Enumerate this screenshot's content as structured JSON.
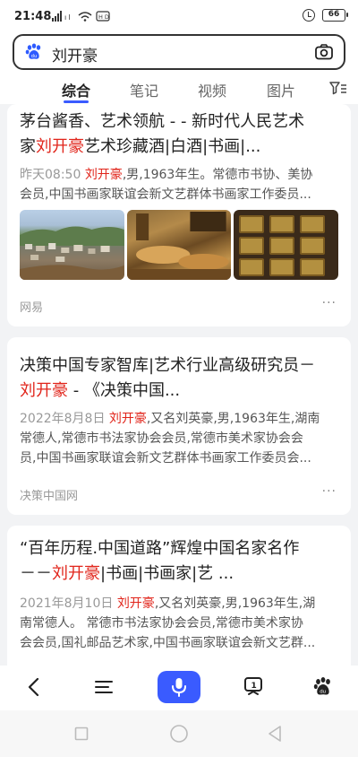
{
  "status_bar": {
    "time": "21:48",
    "left_icons": "Ⓢ ᴵ ⊙ ↗",
    "battery": "66"
  },
  "search": {
    "query": "刘开豪"
  },
  "tabs": [
    {
      "label": "综合",
      "active": true
    },
    {
      "label": "笔记",
      "active": false
    },
    {
      "label": "视频",
      "active": false
    },
    {
      "label": "图片",
      "active": false
    }
  ],
  "results": [
    {
      "title_line1": "茅台酱香、艺术领航 - - 新时代人民艺术",
      "title_line2_pre": "家",
      "title_line2_hl": "刘开豪",
      "title_line2_post": "艺术珍藏酒|白酒|书画|...",
      "snippet_date": "昨天08:50",
      "snippet_hl": "刘开豪",
      "snippet_line1_post": ",男,1963年生。常德市书协、美协",
      "snippet_line2": "会员,中国书画家联谊会新文艺群体书画家工作委员...",
      "source": "网易",
      "more": "···"
    },
    {
      "title_line1": "决策中国专家智库|艺术行业高级研究员－",
      "title_line2_hl": "刘开豪",
      "title_line2_post": " - 《决策中国...",
      "snippet_date": "2022年8月8日",
      "snippet_hl": "刘开豪",
      "snippet_line1_post": ",又名刘英豪,男,1963年生,湖南",
      "snippet_line2": "常德人,常德市书法家协会会员,常德市美术家协会会",
      "snippet_line3": "员,中国书画家联谊会新文艺群体书画家工作委员会...",
      "source": "决策中国网",
      "more": "···"
    },
    {
      "title_line1": "“百年历程.中国道路”辉煌中国名家名作",
      "title_line2_pre": "－－",
      "title_line2_hl": "刘开豪",
      "title_line2_post": "|书画|书画家|艺 ...",
      "snippet_date": "2021年8月10日",
      "snippet_hl": "刘开豪",
      "snippet_line1_post": ",又名刘英豪,男,1963年生,湖",
      "snippet_line2": "南常德人。 常德市书法家协会会员,常德市美术家协",
      "snippet_line3": "会会员,国礼邮品艺术家,中国书画家联谊会新文艺群..."
    }
  ],
  "colors": {
    "accent": "#3a5bff",
    "highlight": "#e1251b"
  }
}
